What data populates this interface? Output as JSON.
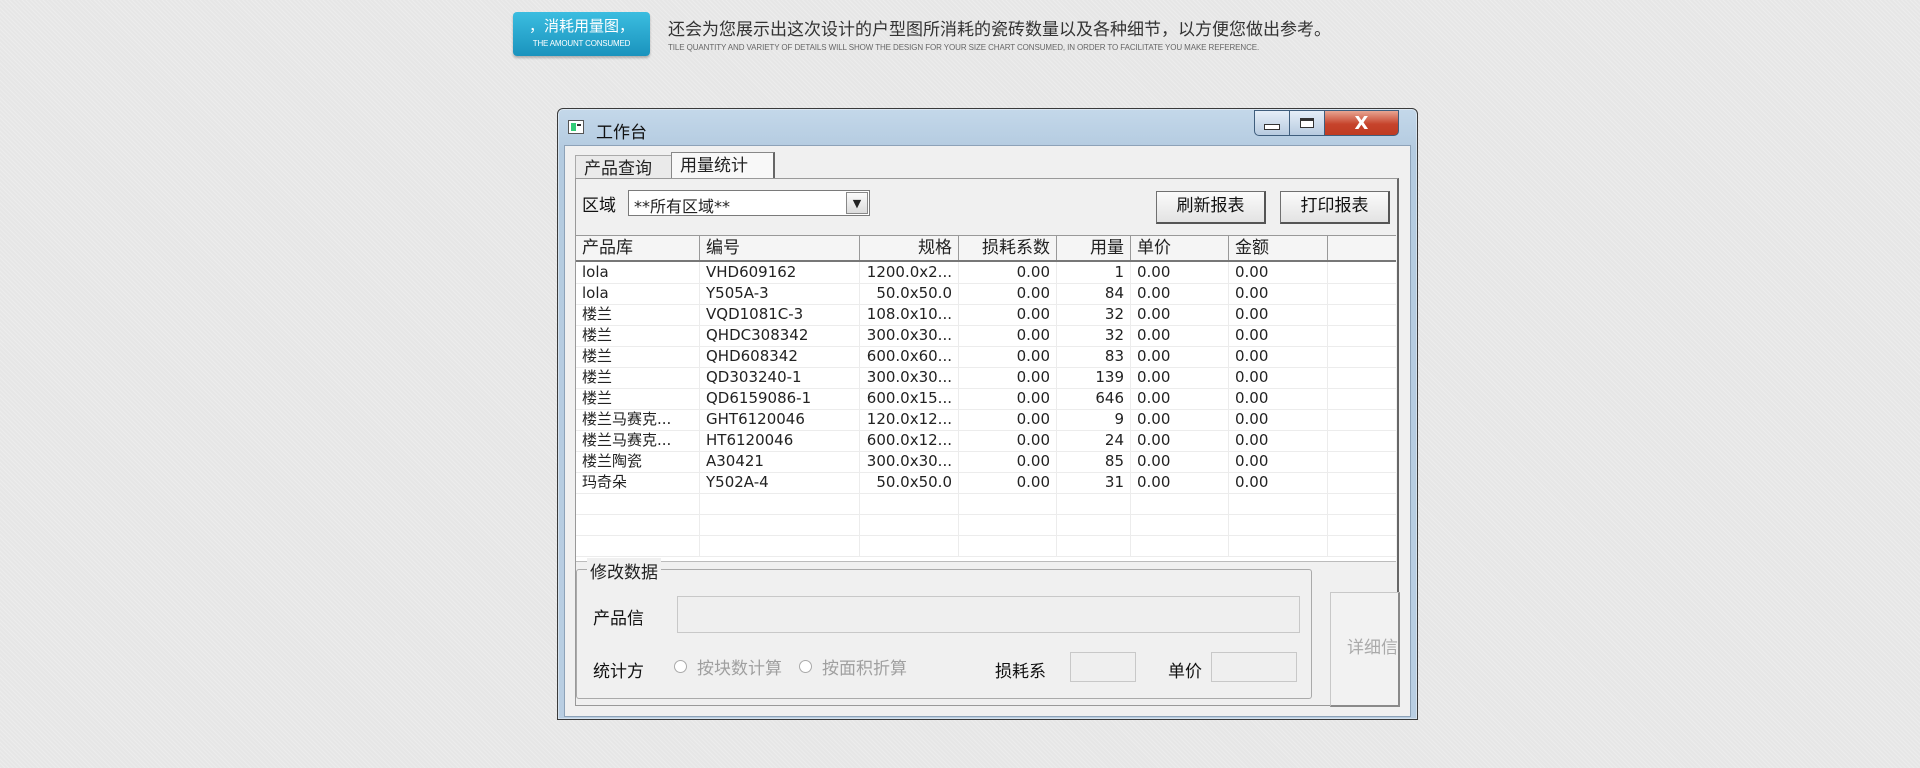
{
  "banner": {
    "badge_title": "，消耗用量图，",
    "badge_sub": "THE AMOUNT CONSUMED",
    "text": "还会为您展示出这次设计的户型图所消耗的瓷砖数量以及各种细节，以方便您做出参考。",
    "sub": "TILE QUANTITY AND VARIETY OF DETAILS WILL SHOW THE DESIGN FOR YOUR SIZE CHART CONSUMED, IN ORDER TO FACILITATE YOU MAKE REFERENCE."
  },
  "window": {
    "title": "工作台",
    "close_glyph": "X",
    "app_icon": "window-app-icon"
  },
  "tabs": [
    "产品查询",
    "用量统计"
  ],
  "filter": {
    "region_label": "区域",
    "region_value": "**所有区域**",
    "refresh_label": "刷新报表",
    "print_label": "打印报表"
  },
  "table": {
    "headers": [
      "产品库",
      "编号",
      "规格",
      "损耗系数",
      "用量",
      "单价",
      "金额"
    ],
    "rows": [
      [
        "lola",
        "VHD609162",
        "1200.0x2...",
        "0.00",
        "1",
        "0.00",
        "0.00"
      ],
      [
        "lola",
        "Y505A-3",
        "50.0x50.0",
        "0.00",
        "84",
        "0.00",
        "0.00"
      ],
      [
        "楼兰",
        "VQD1081C-3",
        "108.0x10...",
        "0.00",
        "32",
        "0.00",
        "0.00"
      ],
      [
        "楼兰",
        "QHDC308342",
        "300.0x30...",
        "0.00",
        "32",
        "0.00",
        "0.00"
      ],
      [
        "楼兰",
        "QHD608342",
        "600.0x60...",
        "0.00",
        "83",
        "0.00",
        "0.00"
      ],
      [
        "楼兰",
        "QD303240-1",
        "300.0x30...",
        "0.00",
        "139",
        "0.00",
        "0.00"
      ],
      [
        "楼兰",
        "QD6159086-1",
        "600.0x15...",
        "0.00",
        "646",
        "0.00",
        "0.00"
      ],
      [
        "楼兰马赛克...",
        "GHT6120046",
        "120.0x12...",
        "0.00",
        "9",
        "0.00",
        "0.00"
      ],
      [
        "楼兰马赛克...",
        "HT6120046",
        "600.0x12...",
        "0.00",
        "24",
        "0.00",
        "0.00"
      ],
      [
        "楼兰陶瓷",
        "A30421",
        "300.0x30...",
        "0.00",
        "85",
        "0.00",
        "0.00"
      ],
      [
        "玛奇朵",
        "Y502A-4",
        "50.0x50.0",
        "0.00",
        "31",
        "0.00",
        "0.00"
      ]
    ]
  },
  "modify": {
    "group_title": "修改数据",
    "product_info_label": "产品信",
    "product_info_value": "",
    "stat_method_label": "统计方",
    "radio_by_block": "按块数计算",
    "radio_by_area": "按面积折算",
    "loss_label": "损耗系",
    "loss_value": "",
    "price_label": "单价",
    "price_value": "",
    "detail_label": "详细信"
  }
}
